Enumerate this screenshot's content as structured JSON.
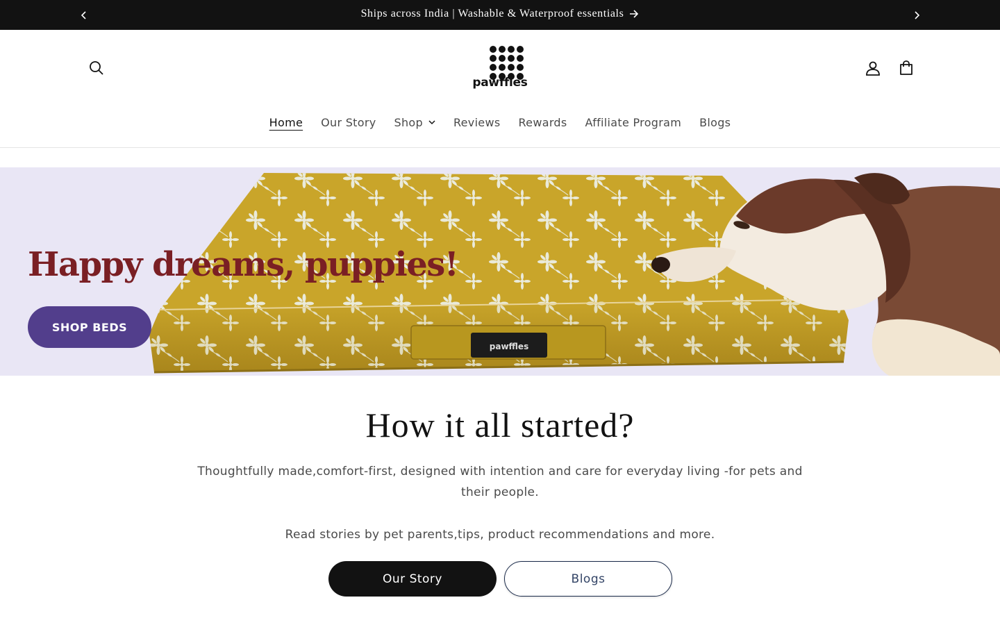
{
  "announcement": {
    "message": "Ships across India | Washable & Waterproof essentials"
  },
  "header": {
    "logo_text": "pawffles",
    "nav": [
      {
        "label": "Home",
        "active": true
      },
      {
        "label": "Our Story"
      },
      {
        "label": "Shop",
        "has_dropdown": true
      },
      {
        "label": "Reviews"
      },
      {
        "label": "Rewards"
      },
      {
        "label": "Affiliate Program"
      },
      {
        "label": "Blogs"
      }
    ]
  },
  "hero": {
    "headline": "Happy dreams, puppies!",
    "cta_label": "SHOP BEDS",
    "bed_tag": "pawffles",
    "colors": {
      "background": "#e9e6f5",
      "bed": "#c9a52a",
      "headline": "#7a1f24",
      "cta": "#523e8c"
    }
  },
  "story": {
    "title": "How it all started?",
    "paragraph1": "Thoughtfully made,comfort-first, designed with intention and care for everyday living -for pets and their people.",
    "paragraph2": "Read stories by pet parents,tips, product recommendations and more.",
    "primary_button": "Our Story",
    "secondary_button": "Blogs"
  },
  "icons": [
    "chevron-left-icon",
    "chevron-right-icon",
    "arrow-right-icon",
    "search-icon",
    "account-icon",
    "cart-icon",
    "chevron-down-icon"
  ]
}
